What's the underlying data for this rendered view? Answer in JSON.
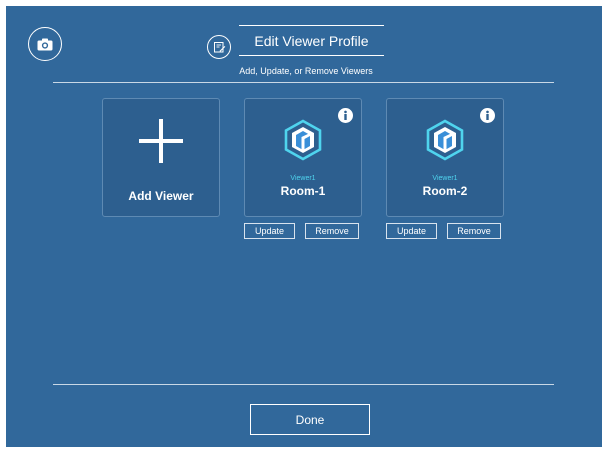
{
  "header": {
    "camera_icon": "camera-icon",
    "edit_icon": "edit-profile-icon",
    "title": "Edit Viewer Profile",
    "subtitle": "Add, Update, or Remove Viewers"
  },
  "add_card": {
    "icon": "plus-icon",
    "label": "Add Viewer"
  },
  "viewers": [
    {
      "tag": "Viewer1",
      "name": "Room-1",
      "icon": "room-hexagon-icon",
      "info_icon": "info-icon",
      "update_label": "Update",
      "remove_label": "Remove"
    },
    {
      "tag": "Viewer1",
      "name": "Room-2",
      "icon": "room-hexagon-icon",
      "info_icon": "info-icon",
      "update_label": "Update",
      "remove_label": "Remove"
    }
  ],
  "footer": {
    "done_label": "Done"
  },
  "colors": {
    "background": "#31689b",
    "card": "#2d5f8f",
    "accent": "#4fd4ee",
    "text": "#ffffff"
  }
}
